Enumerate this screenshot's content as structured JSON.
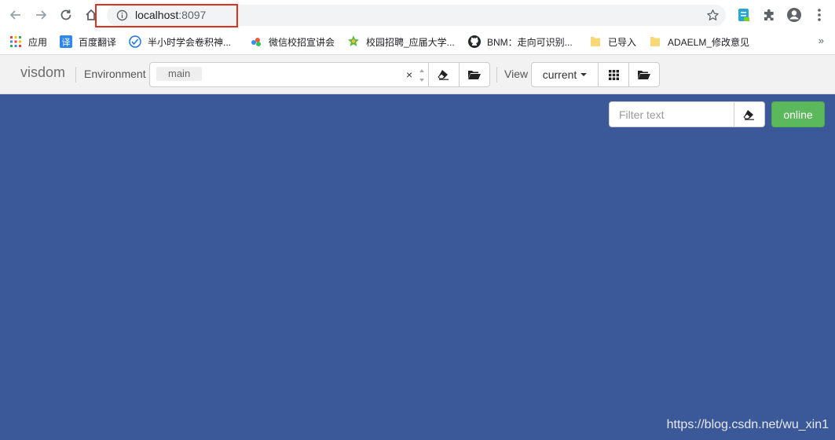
{
  "browser": {
    "url_host": "localhost",
    "url_port": ":8097",
    "bookmarks_overflow": "»",
    "bookmarks": [
      {
        "label": "应用",
        "icon": "apps-grid-icon"
      },
      {
        "label": "百度翻译",
        "icon": "translate-icon"
      },
      {
        "label": "半小时学会卷积神...",
        "icon": "globe-icon"
      },
      {
        "label": "微信校招宣讲会",
        "icon": "dots-icon"
      },
      {
        "label": "校园招聘_应届大学...",
        "icon": "star-badge-icon"
      },
      {
        "label": "BNM：走向可识别...",
        "icon": "github-icon"
      },
      {
        "label": "已导入",
        "icon": "folder-icon"
      },
      {
        "label": "ADAELM_修改意见",
        "icon": "folder-icon"
      }
    ]
  },
  "toolbar": {
    "brand": "visdom",
    "environment_label": "Environment",
    "environment_tag": "main",
    "environment_clear": "×",
    "view_label": "View",
    "view_current": "current"
  },
  "main": {
    "filter_placeholder": "Filter text",
    "status_button": "online",
    "status_color": "#5cb85c",
    "background_color": "#3b5998"
  },
  "watermark": "https://blog.csdn.net/wu_xin1"
}
